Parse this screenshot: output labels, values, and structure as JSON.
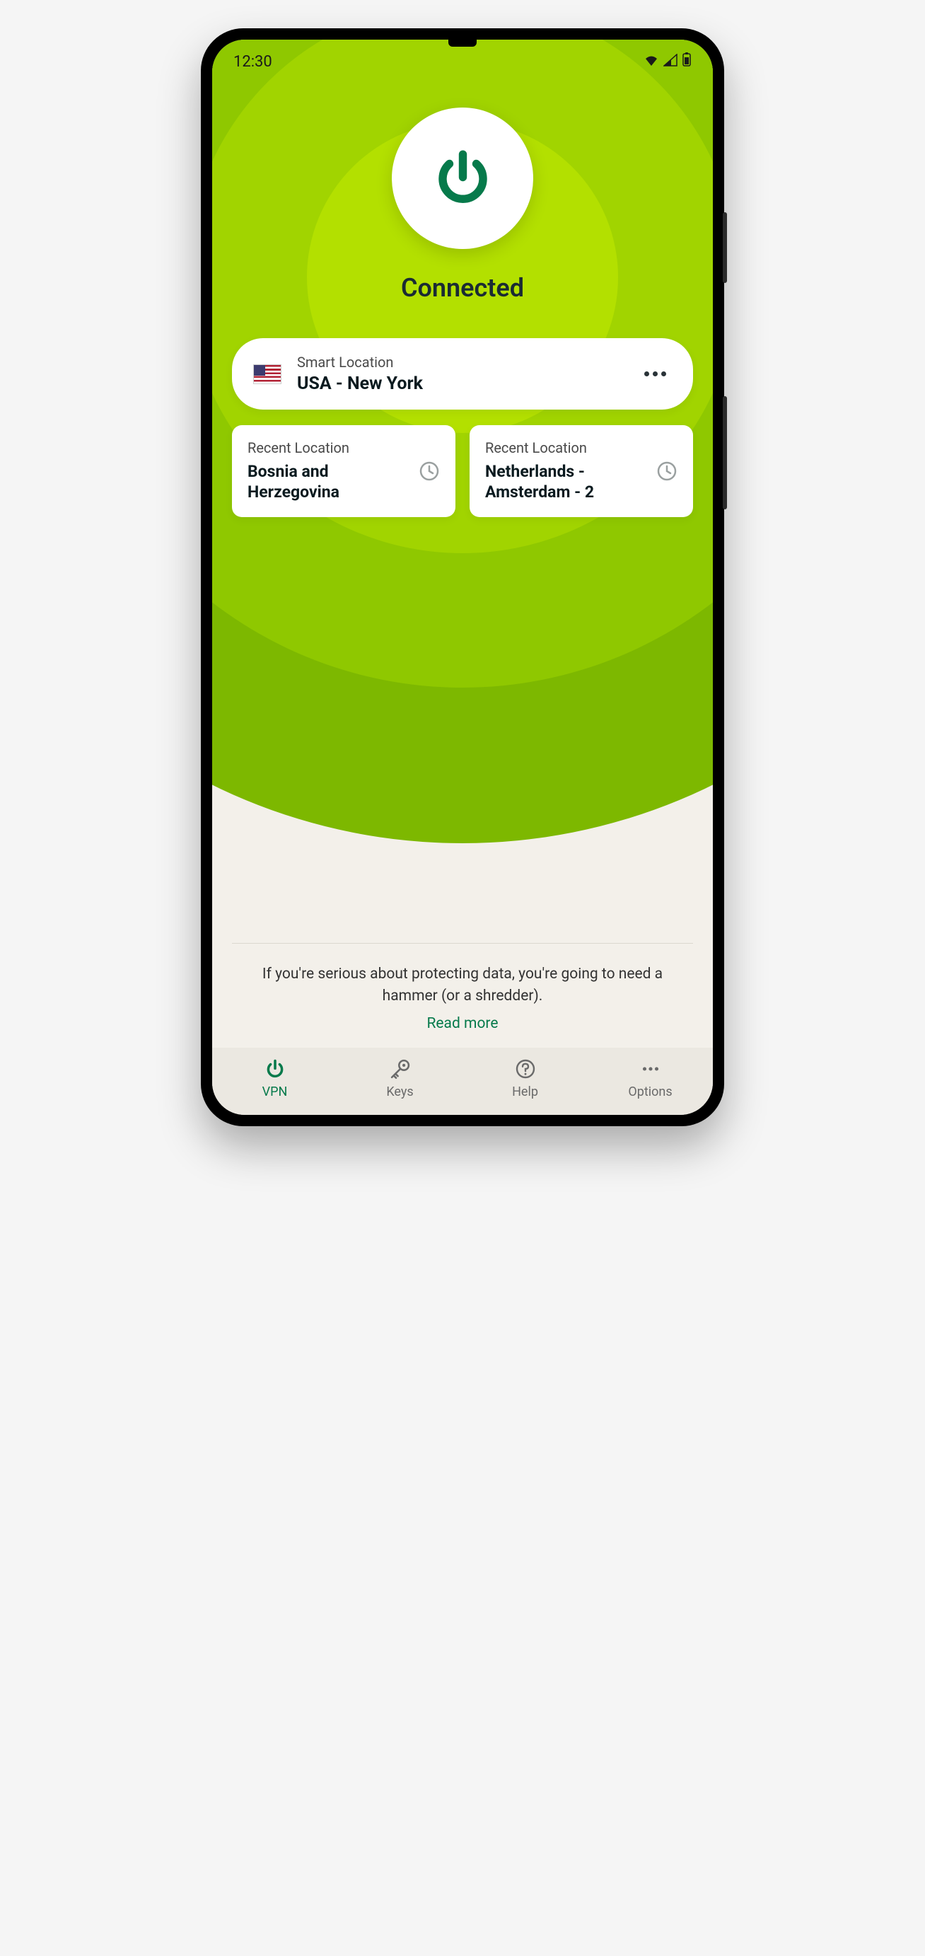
{
  "statusbar": {
    "time": "12:30"
  },
  "connection": {
    "status": "Connected"
  },
  "smart": {
    "label": "Smart Location",
    "value": "USA - New York"
  },
  "recent": [
    {
      "label": "Recent Location",
      "value": "Bosnia and Herzegovina"
    },
    {
      "label": "Recent Location",
      "value": "Netherlands - Amsterdam - 2"
    }
  ],
  "tip": {
    "text": "If you're serious about protecting data, you're going to need a hammer (or a shredder).",
    "more": "Read more"
  },
  "tabs": [
    {
      "label": "VPN"
    },
    {
      "label": "Keys"
    },
    {
      "label": "Help"
    },
    {
      "label": "Options"
    }
  ],
  "colors": {
    "accent": "#067a4b"
  }
}
